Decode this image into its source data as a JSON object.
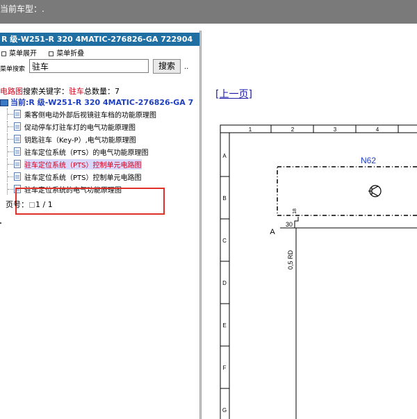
{
  "window": {
    "title": "当前车型：."
  },
  "vehicle": {
    "name": "R 级-W251-R 320 4MATIC-276826-GA 722904"
  },
  "menu": {
    "expand_label": "菜单展开",
    "collapse_label": "菜单折叠"
  },
  "search": {
    "label": "菜单搜索",
    "value": "驻车",
    "button_label": "搜索",
    "extra": ".."
  },
  "keyword_line": {
    "prefix": "电路图",
    "middle": "搜索关键字：",
    "keyword": "驻车",
    "total_label": "总数量：",
    "total": "7"
  },
  "current": {
    "label": "当前:R 级-W251-R 320 4MATIC-276826-GA 7"
  },
  "tree": {
    "items": [
      {
        "label": "乘客侧电动外部后视镜驻车档的功能原理图"
      },
      {
        "label": "促动停车灯驻车灯的电气功能原理图"
      },
      {
        "label": "钥匙驻车（Key-P）,电气功能原理图"
      },
      {
        "label": "驻车定位系统（PTS）的电气功能原理图"
      },
      {
        "label": "驻车定位系统（PTS）控制单元电路图"
      },
      {
        "label": "驻车定位系统（PTS）控制单元电路图"
      },
      {
        "label": "驻车定位系统的电气功能原理图"
      }
    ]
  },
  "pager": {
    "label": "页号：",
    "value": "1 / 1"
  },
  "viewer": {
    "prev_link": "[上一页]",
    "col_numbers": [
      "1",
      "2",
      "3",
      "4"
    ],
    "row_letters": [
      "A",
      "B",
      "C",
      "D",
      "E",
      "F",
      "G"
    ],
    "component": "N62",
    "connector_letter": "A",
    "pin": "30",
    "wire_label": "0,5 RD",
    "pin_top": "18"
  }
}
